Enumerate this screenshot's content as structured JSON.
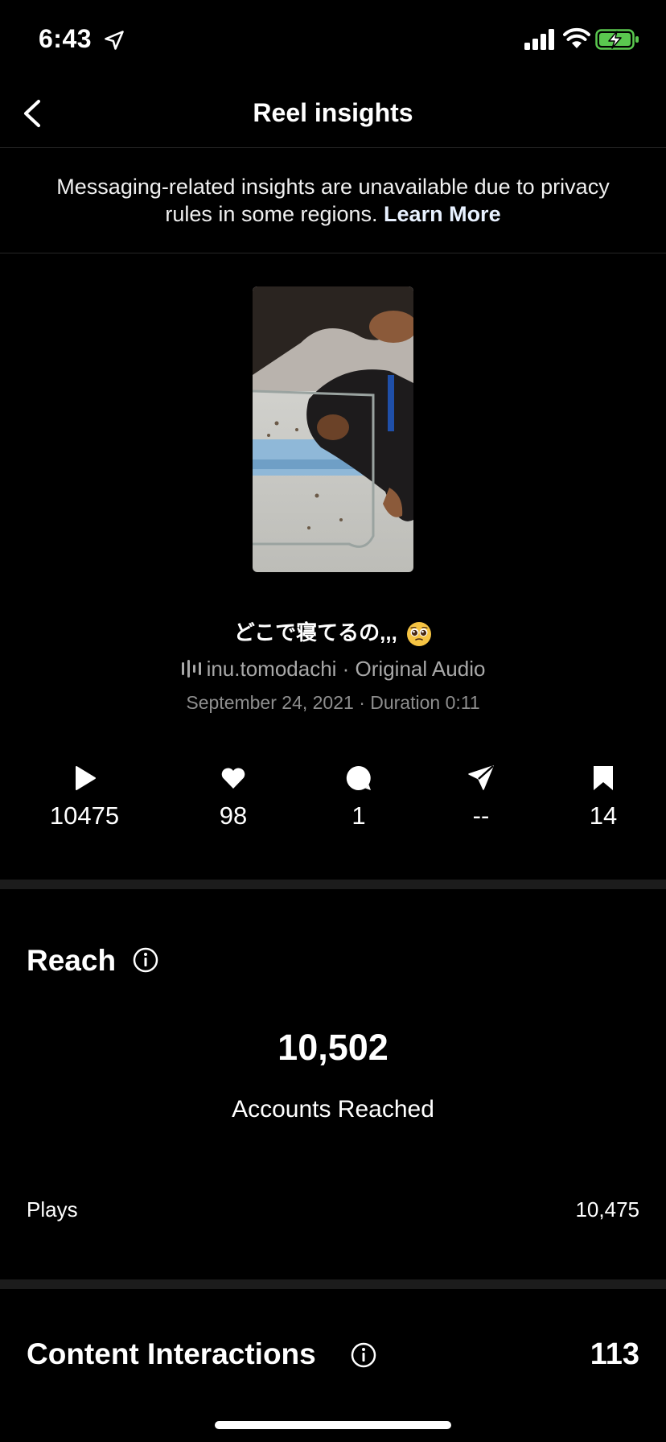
{
  "status_bar": {
    "time": "6:43",
    "icons": [
      "location-arrow-icon",
      "cellular-signal-icon",
      "wifi-icon",
      "battery-charging-icon"
    ],
    "battery_color": "#5ac84f"
  },
  "nav": {
    "title": "Reel insights",
    "back_icon": "chevron-left-icon"
  },
  "banner": {
    "text": "Messaging-related insights are unavailable due to privacy rules in some regions.",
    "link": "Learn More"
  },
  "reel": {
    "caption": "どこで寝てるの,,,",
    "caption_emoji": "pleading-face-emoji",
    "audio": "inu.tomodachi · Original Audio",
    "date_duration": "September 24, 2021 · Duration 0:11"
  },
  "stats": [
    {
      "icon": "play-icon",
      "value": "10475"
    },
    {
      "icon": "heart-icon",
      "value": "98"
    },
    {
      "icon": "comment-icon",
      "value": "1"
    },
    {
      "icon": "share-icon",
      "value": "--"
    },
    {
      "icon": "bookmark-icon",
      "value": "14"
    }
  ],
  "reach": {
    "title": "Reach",
    "accounts_reached": "10,502",
    "accounts_reached_label": "Accounts Reached",
    "plays_label": "Plays",
    "plays_value": "10,475"
  },
  "content_interactions": {
    "title": "Content Interactions",
    "value": "113"
  },
  "colors": {
    "background": "#000000",
    "divider": "#1c1c1c",
    "secondary_text": "#a8a8a8"
  }
}
